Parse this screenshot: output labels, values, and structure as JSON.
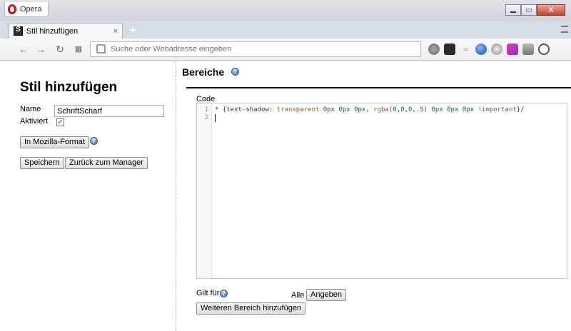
{
  "browser": {
    "menu_label": "Opera",
    "tab_title": "Stil hinzufügen",
    "tab_close": "×",
    "new_tab": "+",
    "address_placeholder": "Suche oder Webadresse eingeben",
    "window_close": "X"
  },
  "page": {
    "title": "Stil hinzufügen",
    "name_label": "Name",
    "name_value": "SchriftScharf",
    "activated_label": "Aktiviert",
    "activated_checked": true,
    "mozilla_format_button": "In Mozilla-Format",
    "save_button": "Speichern",
    "back_button": "Zurück zum Manager"
  },
  "sections": {
    "title": "Bereiche",
    "code_label": "Code",
    "line_numbers": [
      "1",
      "2"
    ],
    "code_line_1": {
      "a": "* {text-shadow: ",
      "b": "transparent",
      "c": " 0px 0px 0px, ",
      "d": "rgba",
      "e": "(0,0,0,.5) 0px 0px 0px ",
      "f": "!important",
      "g": "}/"
    },
    "applies_to_label": "Gilt für",
    "all_label": "Alle",
    "specify_button": "Angeben",
    "add_section_button": "Weiteren Bereich hinzufügen"
  },
  "colors": {
    "opera_red": "#cc0f16",
    "help_icon_blue": "#3f6fc1"
  }
}
